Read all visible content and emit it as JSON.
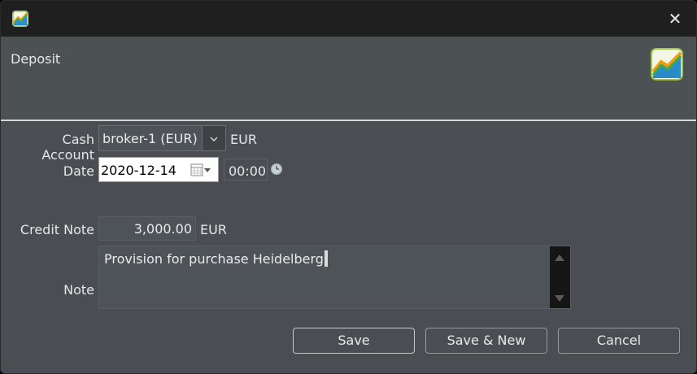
{
  "window": {
    "close_glyph": "✕"
  },
  "header": {
    "title": "Deposit",
    "logo_icon": "chart-logo-icon"
  },
  "form": {
    "cash_account": {
      "label": "Cash Account",
      "value": "broker-1 (EUR)",
      "currency": "EUR"
    },
    "date": {
      "label": "Date",
      "value": "2020-12-14",
      "time": "00:00"
    },
    "credit_note": {
      "label": "Credit Note",
      "value": "3,000.00",
      "currency": "EUR"
    },
    "note": {
      "label": "Note",
      "value": "Provision for purchase Heidelberg"
    }
  },
  "buttons": {
    "save": "Save",
    "save_new": "Save & New",
    "cancel": "Cancel"
  },
  "colors": {
    "titlebar": "#1f1f1f",
    "background": "#4a4e52",
    "separator": "#d7d7d7"
  }
}
